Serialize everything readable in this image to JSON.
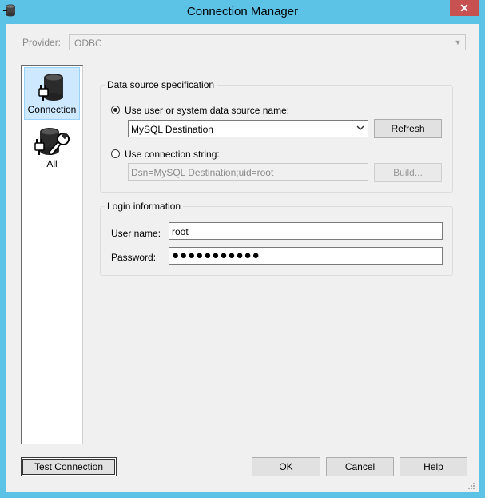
{
  "window": {
    "title": "Connection Manager",
    "close_glyph": "✕"
  },
  "provider": {
    "label": "Provider:",
    "value": "ODBC"
  },
  "sidebar": {
    "items": [
      {
        "label": "Connection",
        "icon": "database-plug-icon",
        "selected": true
      },
      {
        "label": "All",
        "icon": "database-wrench-icon",
        "selected": false
      }
    ]
  },
  "data_source": {
    "group_title": "Data source specification",
    "dsn_option_label": "Use user or system data source name:",
    "dsn_value": "MySQL Destination",
    "refresh_label": "Refresh",
    "conn_string_option_label": "Use connection string:",
    "conn_string_value": "Dsn=MySQL Destination;uid=root",
    "build_label": "Build..."
  },
  "login": {
    "group_title": "Login information",
    "username_label": "User name:",
    "username_value": "root",
    "password_label": "Password:",
    "password_mask": "●●●●●●●●●●●"
  },
  "footer": {
    "test_label": "Test Connection",
    "ok_label": "OK",
    "cancel_label": "Cancel",
    "help_label": "Help"
  },
  "colors": {
    "title_bar": "#5cc2e6",
    "close_button": "#c75050",
    "selection": "#cde8ff"
  }
}
